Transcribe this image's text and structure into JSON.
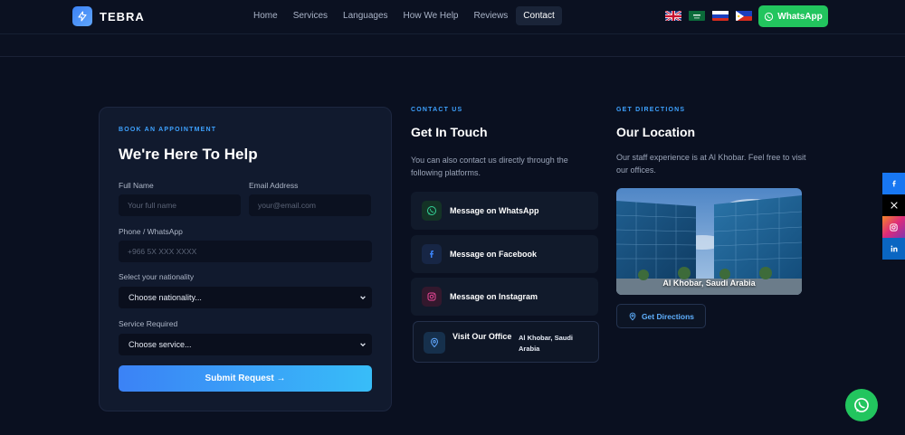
{
  "header": {
    "brand": "TEBRA",
    "nav": [
      "Home",
      "Services",
      "Languages",
      "How We Help",
      "Reviews",
      "Contact"
    ],
    "active_nav": "Contact",
    "flags": [
      "uk-flag",
      "saudi-flag",
      "russia-flag",
      "philippines-flag"
    ],
    "whatsapp_label": "WhatsApp"
  },
  "form": {
    "eyebrow": "BOOK AN APPOINTMENT",
    "title": "We're Here To Help",
    "full_name_label": "Full Name",
    "full_name_placeholder": "Your full name",
    "email_label": "Email Address",
    "email_placeholder": "your@email.com",
    "phone_label": "Phone / WhatsApp",
    "phone_placeholder": "+966 5X XXX XXXX",
    "nationality_label": "Select your nationality",
    "nationality_value": "Choose nationality...",
    "service_label": "Service Required",
    "service_value": "Choose service...",
    "submit_label": "Submit Request →"
  },
  "contact": {
    "eyebrow": "CONTACT US",
    "title": "Get In Touch",
    "description": "You can also contact us directly through the following platforms.",
    "whatsapp": "Message on WhatsApp",
    "facebook": "Message on Facebook",
    "instagram": "Message on Instagram",
    "office_label": "Visit Our Office",
    "office_address": "Al Khobar, Saudi Arabia"
  },
  "location": {
    "eyebrow": "GET DIRECTIONS",
    "title": "Our Location",
    "description": "Our staff experience is at Al Khobar. Feel free to visit our offices.",
    "photo_caption": "Al Khobar, Saudi Arabia",
    "directions_label": "Get Directions"
  },
  "colors": {
    "accent": "#3ea2ff",
    "whatsapp": "#22c55e",
    "background": "#0a1020",
    "card": "#111a2e"
  }
}
